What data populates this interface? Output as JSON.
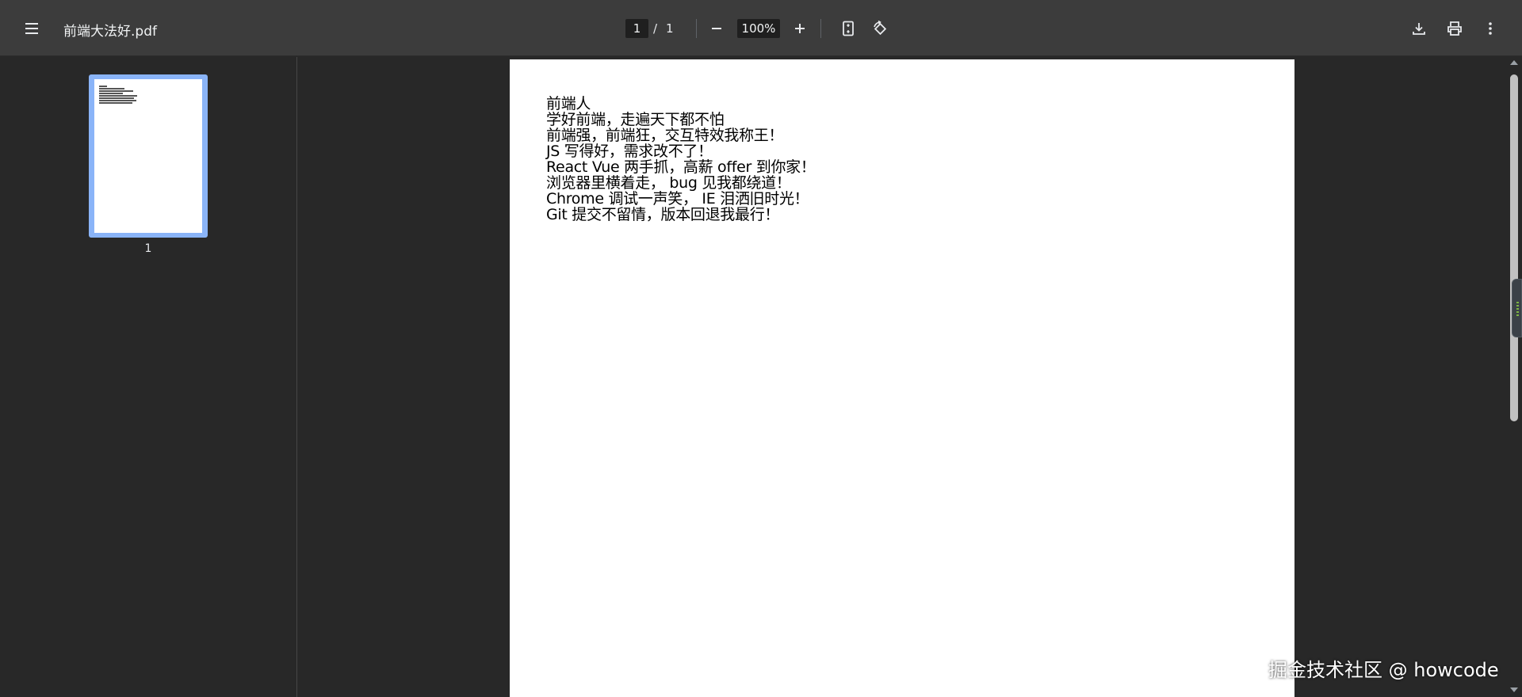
{
  "toolbar": {
    "menu_icon": "hamburger-menu-icon",
    "title": "前端大法好.pdf",
    "page_current": "1",
    "page_separator": "/",
    "page_total": "1",
    "zoom_value": "100%",
    "icons": {
      "zoom_out": "minus-icon",
      "zoom_in": "plus-icon",
      "fit": "fit-to-page-icon",
      "rotate": "rotate-icon",
      "download": "download-icon",
      "print": "print-icon",
      "more": "more-vert-icon"
    }
  },
  "sidebar": {
    "thumbnails": [
      {
        "label": "1",
        "selected": true
      }
    ]
  },
  "document": {
    "lines": [
      "前端人",
      "学好前端，走遍天下都不怕",
      "前端强，前端狂，交互特效我称王！",
      "JS 写得好，需求改不了！",
      "React Vue 两手抓，高薪 offer 到你家！",
      "浏览器里横着走， bug 见我都绕道！",
      "Chrome 调试一声笑， IE 泪洒旧时光！",
      "Git 提交不留情，版本回退我最行！"
    ]
  },
  "watermark": "掘金技术社区 @ howcode",
  "colors": {
    "toolbar_bg": "#3c3c3c",
    "viewer_bg": "#282828",
    "thumb_selected": "#8ab4f8",
    "page_bg": "#ffffff"
  }
}
